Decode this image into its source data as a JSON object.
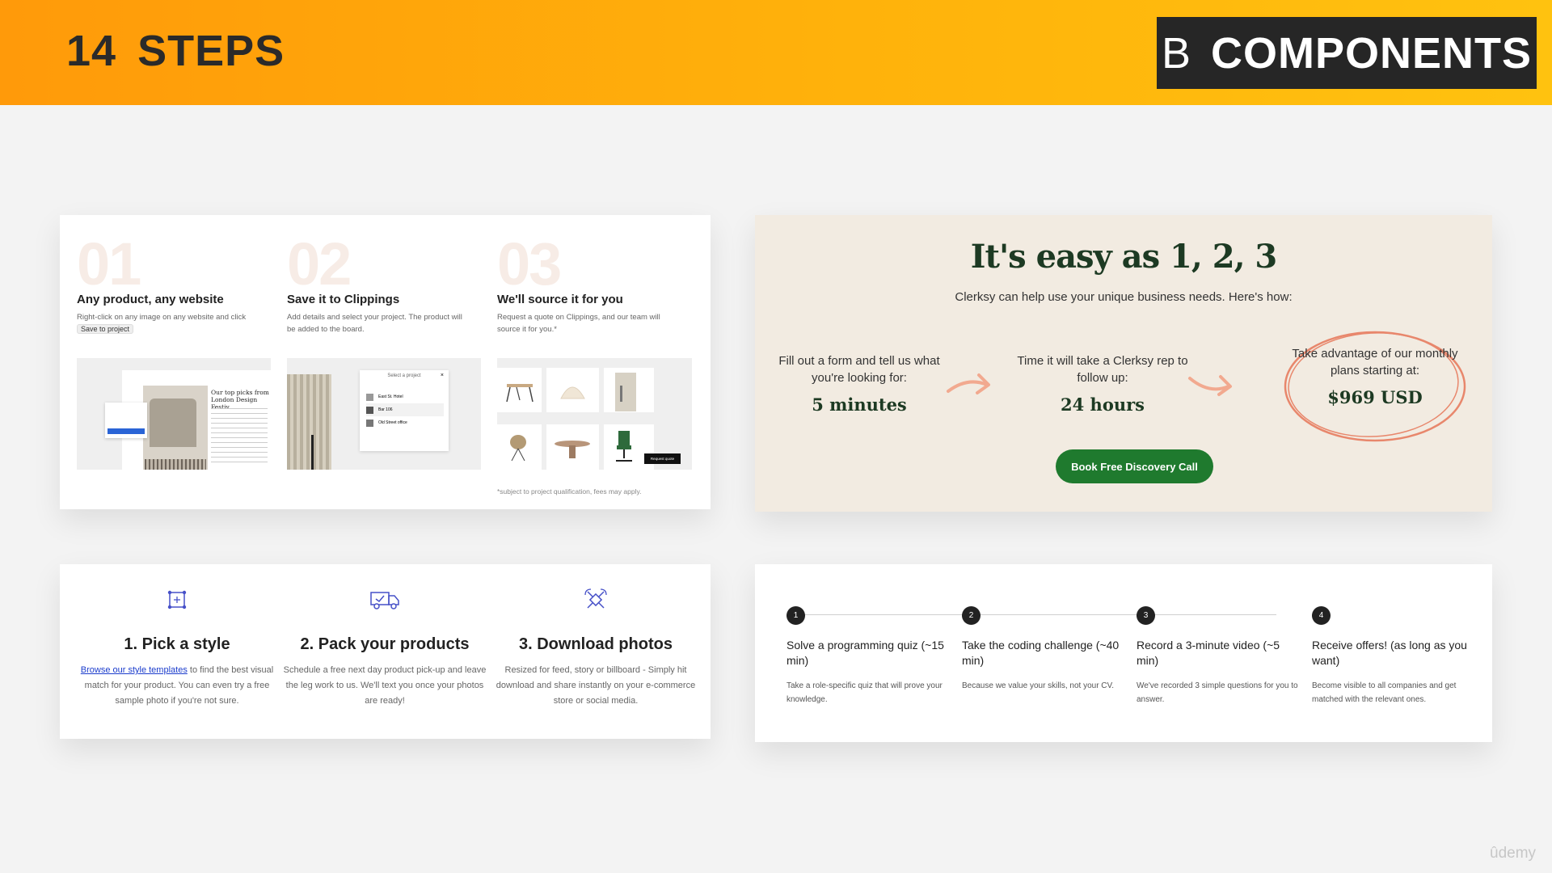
{
  "header": {
    "steps_number": "14",
    "steps_label": "STEPS",
    "badge_letter": "B",
    "badge_label": "COMPONENTS"
  },
  "card1": {
    "columns": [
      {
        "number": "01",
        "title": "Any product, any website",
        "desc": "Right-click on any image on any website and click",
        "pill": "Save to project"
      },
      {
        "number": "02",
        "title": "Save it to Clippings",
        "desc": "Add details and select your project. The product will be added to the board."
      },
      {
        "number": "03",
        "title": "We'll source it for you",
        "desc": "Request a quote on Clippings, and our team will source it for you.*"
      }
    ],
    "shot1_text": "Our top picks from London Design Festiv",
    "shot2": {
      "header": "Select a project",
      "items": [
        "East St. Hotel",
        "Bar 106",
        "Old Street office"
      ]
    },
    "shot3_button": "Request quote",
    "footnote": "*subject to project qualification, fees may apply."
  },
  "card2": {
    "heading": "It's easy as 1, 2, 3",
    "subheading": "Clerksy can help use your unique business needs. Here's how:",
    "steps": [
      {
        "text": "Fill out a form and tell us what you're looking for:",
        "value": "5 minutes"
      },
      {
        "text": "Time it will take a Clerksy rep to follow up:",
        "value": "24 hours"
      },
      {
        "text": "Take advantage of our monthly plans starting at:",
        "value": "$969 USD"
      }
    ],
    "cta": "Book Free Discovery Call",
    "colors": {
      "accent": "#1f7a2e",
      "arrow": "#f2a98f",
      "heading": "#1d3a23"
    }
  },
  "card3": {
    "columns": [
      {
        "icon": "frame-grid-icon",
        "title": "1. Pick a style",
        "link": "Browse our style templates",
        "desc": " to find the best visual match for your product. You can even try a free sample photo if you're not sure."
      },
      {
        "icon": "delivery-truck-icon",
        "title": "2. Pack your products",
        "desc": "Schedule a free next day product pick-up and leave the leg work to us. We'll text you once your photos are ready!"
      },
      {
        "icon": "satellite-share-icon",
        "title": "3. Download photos",
        "desc": "Resized for feed, story or billboard - Simply hit download and share instantly on your e-commerce store or social media."
      }
    ]
  },
  "card4": {
    "steps": [
      {
        "n": "1",
        "title": "Solve a programming quiz (~15 min)",
        "desc": "Take a role-specific quiz that will prove your knowledge."
      },
      {
        "n": "2",
        "title": "Take the coding challenge (~40 min)",
        "desc": "Because we value your skills, not your CV."
      },
      {
        "n": "3",
        "title": "Record a 3-minute video (~5 min)",
        "desc": "We've recorded 3 simple questions for you to answer."
      },
      {
        "n": "4",
        "title": "Receive offers! (as long as you want)",
        "desc": "Become visible to all companies and get matched with the relevant ones."
      }
    ]
  },
  "watermark": "ûdemy"
}
